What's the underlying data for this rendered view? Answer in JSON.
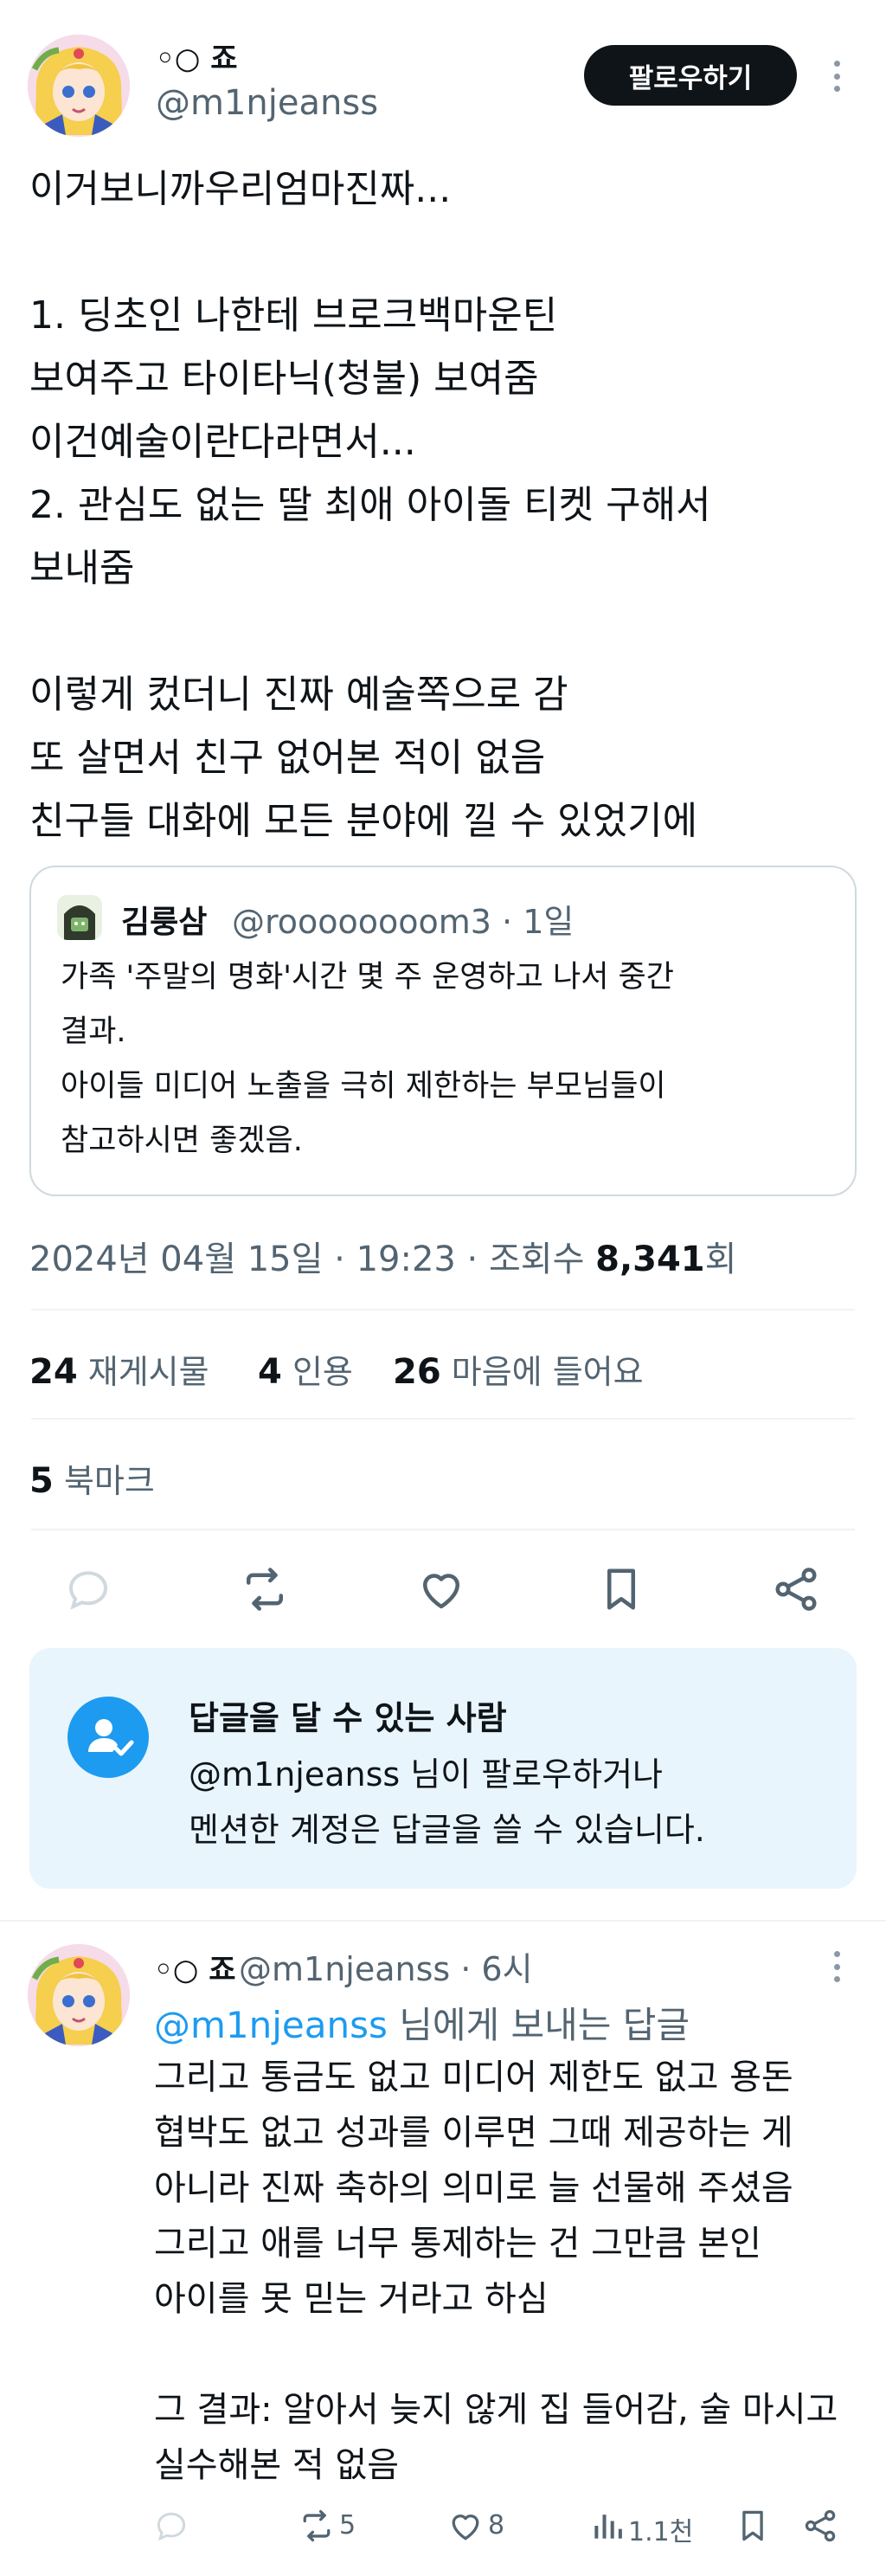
{
  "tweet": {
    "author_name": "◦○ 죠",
    "author_handle": "@m1njeanss",
    "follow_label": "팔로우하기",
    "text": "이거보니까우리엄마진짜...\n\n1. 딩초인 나한테 브로크백마운틴\n보여주고 타이타닉(청불) 보여줌\n이건예술이란다라면서...\n2. 관심도 없는 딸 최애 아이돌 티켓 구해서\n보내줌\n\n이렇게 컸더니 진짜 예술쪽으로 감\n또 살면서 친구 없어본 적이 없음\n친구들 대화에 모든 분야에 낄 수 있었기에"
  },
  "quote": {
    "name": "김룽삼",
    "handle_time": "@roooooooom3 · 1일",
    "text": "가족 '주말의 명화'시간 몇 주 운영하고 나서 중간\n결과.\n아이들 미디어 노출을 극히 제한하는 부모님들이\n참고하시면 좋겠음."
  },
  "meta": {
    "datetime": "2024년 04월 15일 · 19:23 · 조회수 ",
    "views": "8,341",
    "views_suffix": "회"
  },
  "stats": {
    "retweets_count": "24",
    "retweets_label": "재게시물",
    "quotes_count": "4",
    "quotes_label": "인용",
    "likes_count": "26",
    "likes_label": "마음에 들어요",
    "bookmarks_count": "5",
    "bookmarks_label": "북마크"
  },
  "action_icons": [
    "reply-icon",
    "retweet-icon",
    "heart-icon",
    "bookmark-icon",
    "share-icon"
  ],
  "reply_permission": {
    "title": "답글을 달 수 있는 사람",
    "description": "@m1njeanss 님이 팔로우하거나\n멘션한 계정은 답글을 쓸 수 있습니다."
  },
  "reply": {
    "author_name": "◦○ 죠",
    "handle_time": "@m1njeanss · 6시",
    "reply_to_mention": "@m1njeanss",
    "reply_to_suffix": " 님에게 보내는 답글",
    "text": "그리고 통금도 없고 미디어 제한도 없고 용돈\n협박도 없고 성과를 이루면 그때 제공하는 게\n아니라 진짜 축하의 의미로 늘 선물해 주셨음\n그리고 애를 너무 통제하는 건 그만큼 본인\n아이를 못 믿는 거라고 하심\n\n그 결과: 알아서 늦지 않게 집 들어감, 술 마시고\n실수해본 적 없음",
    "retweet_count": "5",
    "like_count": "8",
    "views_count": "1.1천"
  },
  "colors": {
    "accent": "#1d9bf0",
    "text": "#0f1419",
    "secondary": "#536471",
    "divider": "#eff3f4",
    "reply_box": "#e8f5fd"
  }
}
